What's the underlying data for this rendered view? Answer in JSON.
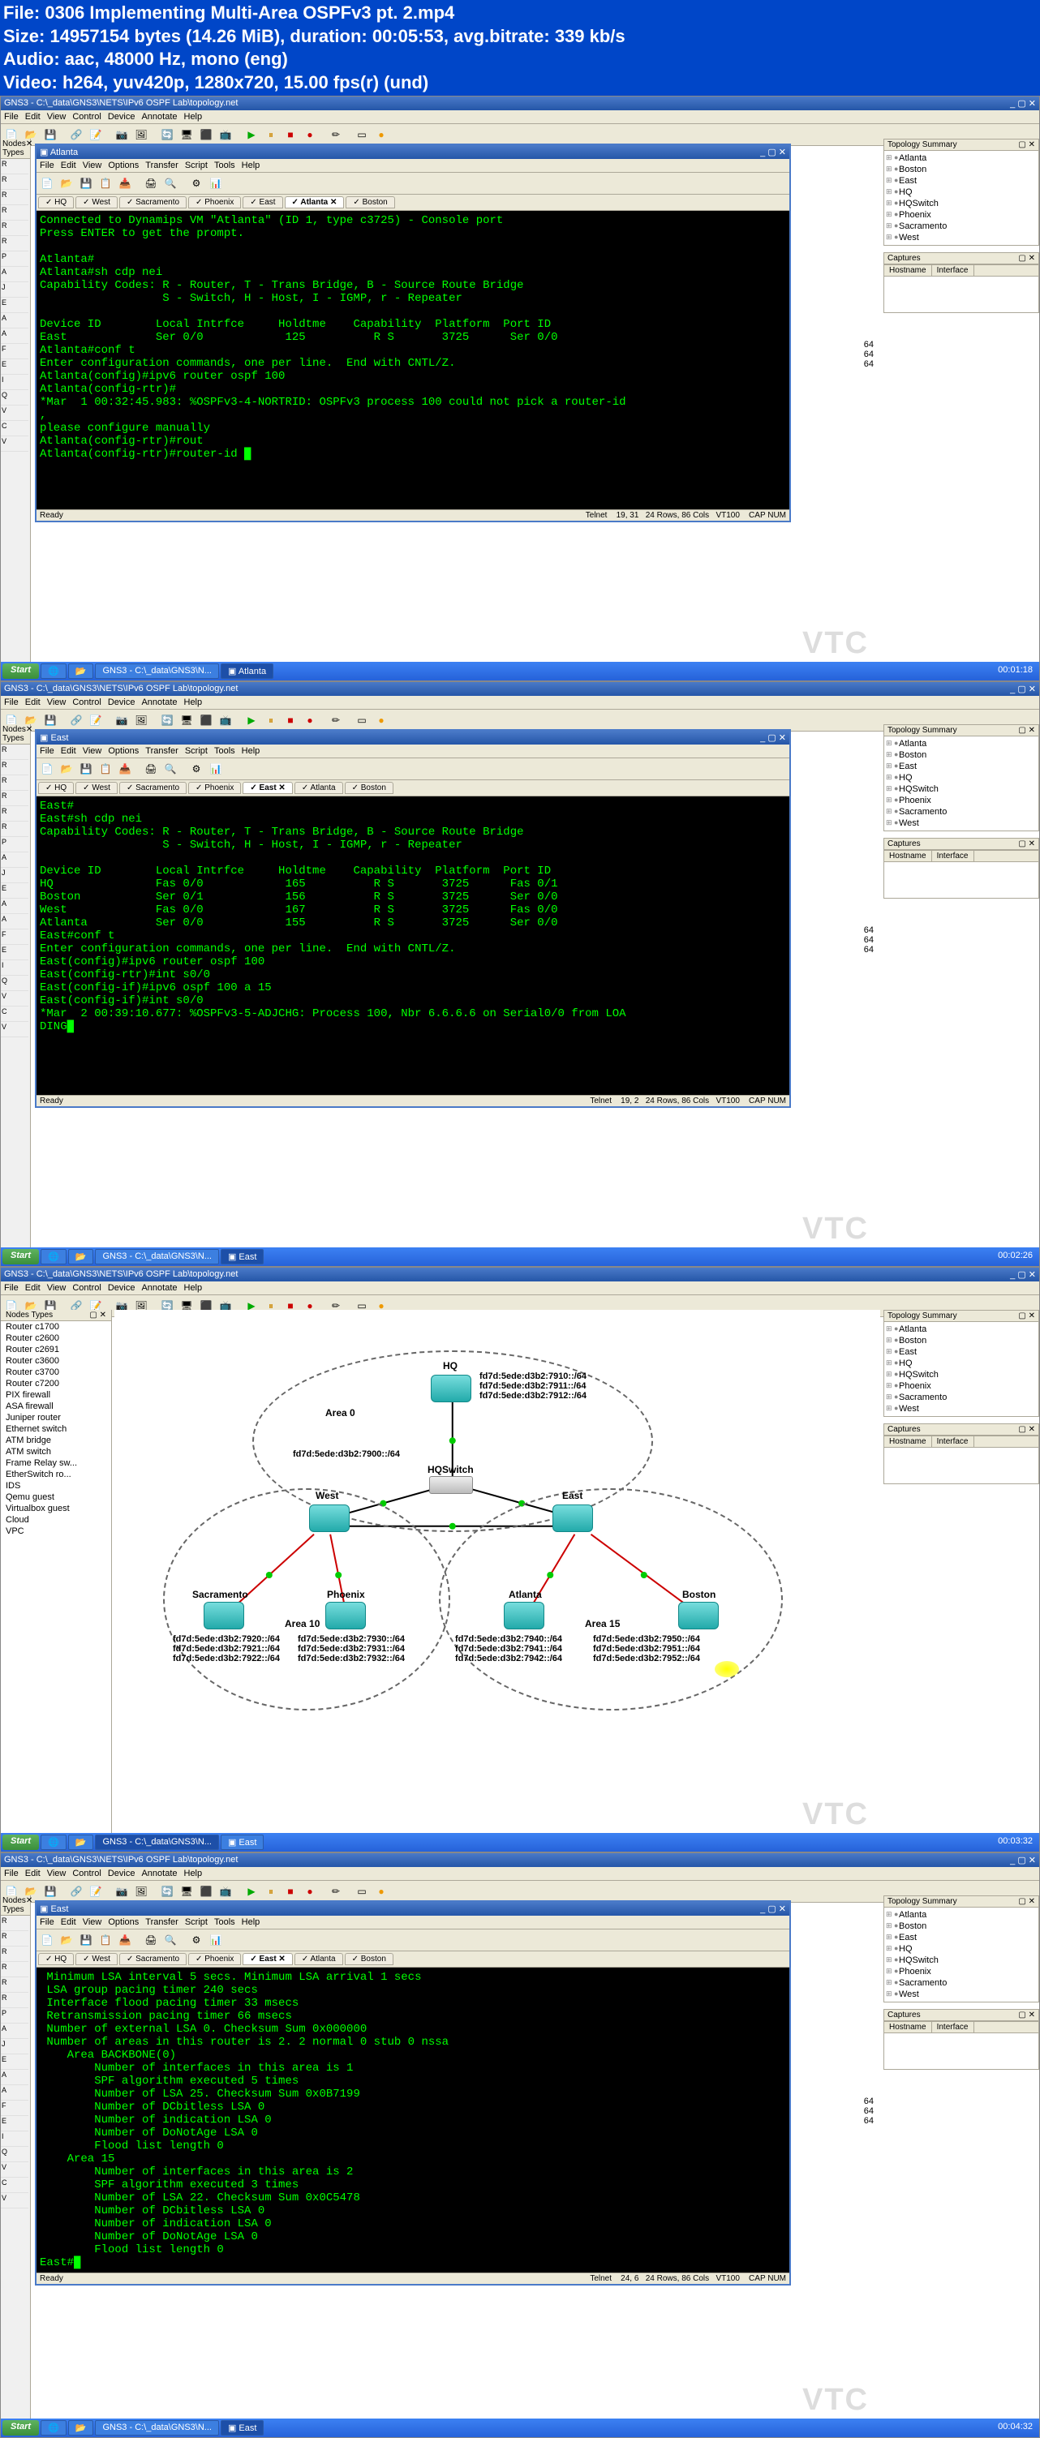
{
  "header": {
    "l1": "File: 0306 Implementing Multi-Area OSPFv3 pt. 2.mp4",
    "l2": "Size: 14957154 bytes (14.26 MiB), duration: 00:05:53, avg.bitrate: 339 kb/s",
    "l3": "Audio: aac, 48000 Hz, mono (eng)",
    "l4": "Video: h264, yuv420p, 1280x720, 15.00 fps(r) (und)"
  },
  "gns_title": "GNS3 - C:\\_data\\GNS3\\NETS\\IPv6 OSPF Lab\\topology.net",
  "menus": {
    "file": "File",
    "edit": "Edit",
    "view": "View",
    "control": "Control",
    "device": "Device",
    "annotate": "Annotate",
    "help": "Help",
    "options": "Options",
    "transfer": "Transfer",
    "script": "Script",
    "tools": "Tools"
  },
  "panels": {
    "nodes": "Nodes Types",
    "topo": "Topology Summary",
    "cap": "Captures",
    "host": "Hostname",
    "iface": "Interface"
  },
  "tree": [
    "Atlanta",
    "Boston",
    "East",
    "HQ",
    "HQSwitch",
    "Phoenix",
    "Sacramento",
    "West"
  ],
  "tabs": {
    "hq": "HQ",
    "west": "West",
    "sac": "Sacramento",
    "phx": "Phoenix",
    "east": "East",
    "atl": "Atlanta",
    "bos": "Boston"
  },
  "status": {
    "ready": "Ready",
    "telnet": "Telnet",
    "caps": "CAP",
    "num": "NUM"
  },
  "frame1": {
    "title": "Atlanta",
    "pos": "19, 31",
    "size": "24 Rows, 86 Cols",
    "vt": "VT100",
    "term": "Connected to Dynamips VM \"Atlanta\" (ID 1, type c3725) - Console port\nPress ENTER to get the prompt.\n\nAtlanta#\nAtlanta#sh cdp nei\nCapability Codes: R - Router, T - Trans Bridge, B - Source Route Bridge\n                  S - Switch, H - Host, I - IGMP, r - Repeater\n\nDevice ID        Local Intrfce     Holdtme    Capability  Platform  Port ID\nEast             Ser 0/0            125          R S       3725      Ser 0/0\nAtlanta#conf t\nEnter configuration commands, one per line.  End with CNTL/Z.\nAtlanta(config)#ipv6 router ospf 100\nAtlanta(config-rtr)#\n*Mar  1 00:32:45.983: %OSPFv3-4-NORTRID: OSPFv3 process 100 could not pick a router-id\n,\nplease configure manually\nAtlanta(config-rtr)#rout\nAtlanta(config-rtr)#router-id █"
  },
  "frame1_clock": "00:01:18",
  "frame2": {
    "title": "East",
    "pos": "19,  2",
    "size": "24 Rows, 86 Cols",
    "vt": "VT100",
    "term": "East#\nEast#sh cdp nei\nCapability Codes: R - Router, T - Trans Bridge, B - Source Route Bridge\n                  S - Switch, H - Host, I - IGMP, r - Repeater\n\nDevice ID        Local Intrfce     Holdtme    Capability  Platform  Port ID\nHQ               Fas 0/0            165          R S       3725      Fas 0/1\nBoston           Ser 0/1            156          R S       3725      Ser 0/0\nWest             Fas 0/0            167          R S       3725      Fas 0/0\nAtlanta          Ser 0/0            155          R S       3725      Ser 0/0\nEast#conf t\nEnter configuration commands, one per line.  End with CNTL/Z.\nEast(config)#ipv6 router ospf 100\nEast(config-rtr)#int s0/0\nEast(config-if)#ipv6 ospf 100 a 15\nEast(config-if)#int s0/0\n*Mar  2 00:39:10.677: %OSPFv3-5-ADJCHG: Process 100, Nbr 6.6.6.6 on Serial0/0 from LOA\nDING█"
  },
  "frame2_clock": "00:02:26",
  "frame3": {
    "nodes": [
      "Router c1700",
      "Router c2600",
      "Router c2691",
      "Router c3600",
      "Router c3700",
      "Router c7200",
      "PIX firewall",
      "ASA firewall",
      "Juniper router",
      "Ethernet switch",
      "ATM bridge",
      "ATM switch",
      "Frame Relay sw...",
      "EtherSwitch ro...",
      "IDS",
      "Qemu guest",
      "Virtualbox guest",
      "Cloud",
      "VPC"
    ],
    "labels": {
      "hq": "HQ",
      "west": "West",
      "east": "East",
      "hqsw": "HQSwitch",
      "sac": "Sacramento",
      "phx": "Phoenix",
      "atl": "Atlanta",
      "bos": "Boston",
      "a0": "Area 0",
      "a10": "Area 10",
      "a15": "Area 15"
    },
    "addr": {
      "hq": "fd7d:5ede:d3b2:7910::/64\nfd7d:5ede:d3b2:7911::/64\nfd7d:5ede:d3b2:7912::/64",
      "west": "fd7d:5ede:d3b2:7900::/64",
      "sac": "fd7d:5ede:d3b2:7920::/64\nfd7d:5ede:d3b2:7921::/64\nfd7d:5ede:d3b2:7922::/64",
      "phx": "fd7d:5ede:d3b2:7930::/64\nfd7d:5ede:d3b2:7931::/64\nfd7d:5ede:d3b2:7932::/64",
      "atl": "fd7d:5ede:d3b2:7940::/64\nfd7d:5ede:d3b2:7941::/64\nfd7d:5ede:d3b2:7942::/64",
      "bos": "fd7d:5ede:d3b2:7950::/64\nfd7d:5ede:d3b2:7951::/64\nfd7d:5ede:d3b2:7952::/64"
    }
  },
  "frame3_clock": "00:03:32",
  "frame4": {
    "title": "East",
    "pos": "24,  6",
    "size": "24 Rows, 86 Cols",
    "vt": "VT100",
    "term": " Minimum LSA interval 5 secs. Minimum LSA arrival 1 secs\n LSA group pacing timer 240 secs\n Interface flood pacing timer 33 msecs\n Retransmission pacing timer 66 msecs\n Number of external LSA 0. Checksum Sum 0x000000\n Number of areas in this router is 2. 2 normal 0 stub 0 nssa\n    Area BACKBONE(0)\n        Number of interfaces in this area is 1\n        SPF algorithm executed 5 times\n        Number of LSA 25. Checksum Sum 0x0B7199\n        Number of DCbitless LSA 0\n        Number of indication LSA 0\n        Number of DoNotAge LSA 0\n        Flood list length 0\n    Area 15\n        Number of interfaces in this area is 2\n        SPF algorithm executed 3 times\n        Number of LSA 22. Checksum Sum 0x0C5478\n        Number of DCbitless LSA 0\n        Number of indication LSA 0\n        Number of DoNotAge LSA 0\n        Flood list length 0\nEast#█"
  },
  "frame4_clock": "00:04:32",
  "taskbar": {
    "start": "Start",
    "gns": "GNS3 - C:\\_data\\GNS3\\N...",
    "east": "East",
    "atl": "Atlanta"
  },
  "vtc": "VTC",
  "topo_partial": "64\n64\n64"
}
